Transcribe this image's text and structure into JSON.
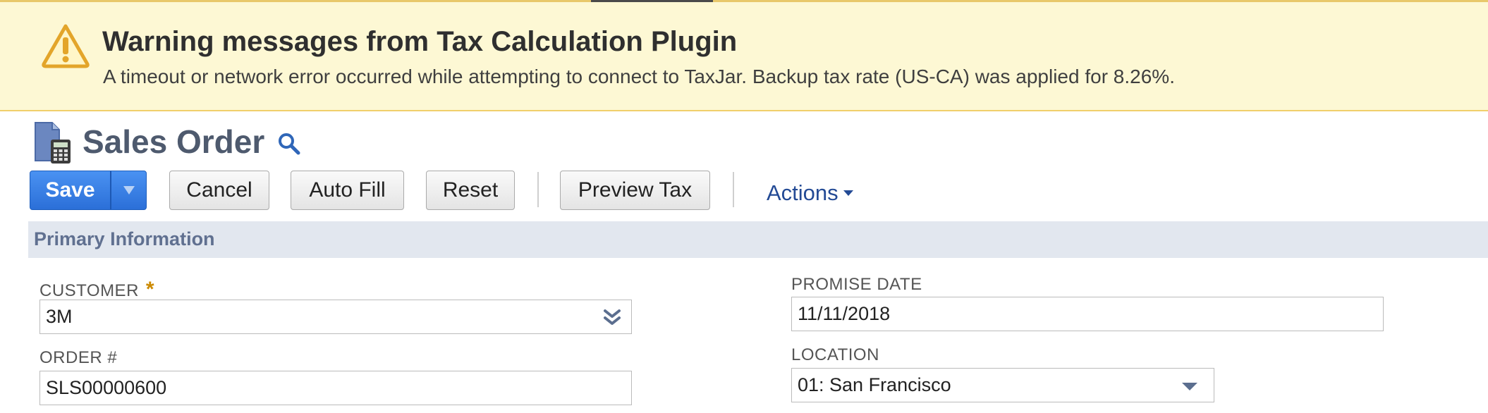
{
  "warning": {
    "title": "Warning messages from Tax Calculation Plugin",
    "message": "A timeout or network error occurred while attempting to connect to TaxJar. Backup tax rate (US-CA) was applied for 8.26%."
  },
  "header": {
    "title": "Sales Order"
  },
  "toolbar": {
    "save_label": "Save",
    "cancel_label": "Cancel",
    "autofill_label": "Auto Fill",
    "reset_label": "Reset",
    "preview_tax_label": "Preview Tax",
    "actions_label": "Actions"
  },
  "section": {
    "title": "Primary Information"
  },
  "fields": {
    "customer": {
      "label": "CUSTOMER",
      "required_mark": "*",
      "value": "3M"
    },
    "order_number": {
      "label": "ORDER #",
      "value": "SLS00000600"
    },
    "promise_date": {
      "label": "PROMISE DATE",
      "value": "11/11/2018"
    },
    "location": {
      "label": "LOCATION",
      "value": "01: San Francisco"
    }
  },
  "colors": {
    "warning_bg": "#fdf8d4",
    "save_blue": "#2b6fd8",
    "title_slate": "#4e5a6e",
    "link_blue": "#234a95",
    "section_bg": "#e2e7ef"
  }
}
